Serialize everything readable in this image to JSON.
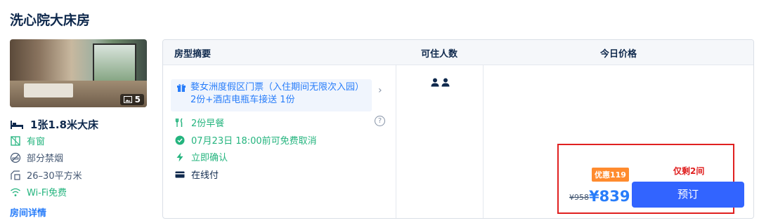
{
  "room": {
    "title": "洗心院大床房",
    "photo_count": "5",
    "bed": "1张1.8米大床",
    "amenities": [
      {
        "label": "有窗",
        "icon": "window-icon"
      },
      {
        "label": "部分禁烟",
        "icon": "no-smoking-icon"
      },
      {
        "label": "26–30平方米",
        "icon": "area-icon"
      },
      {
        "label": "Wi-Fi免费",
        "icon": "wifi-icon"
      }
    ],
    "detail_link": "房间详情"
  },
  "table": {
    "headers": [
      "房型摘要",
      "可住人数",
      "今日价格"
    ],
    "offer": {
      "gift_text": "婺女洲度假区门票（入住期间无限次入园）2份+酒店电瓶车接送 1份",
      "breakfast": "2份早餐",
      "cancel": "07月23日 18:00前可免费取消",
      "confirm": "立即确认",
      "payment": "在线付",
      "occupancy": 2
    },
    "price": {
      "promo_badge": "优惠119",
      "rooms_left": "仅剩2间",
      "original": "¥958",
      "current": "¥839",
      "book_label": "预订"
    }
  },
  "colors": {
    "accent": "#287dfa",
    "book_button": "#3264ff",
    "promo": "#ff8b2e",
    "alert": "#e02020",
    "check_green": "#24b47e"
  }
}
